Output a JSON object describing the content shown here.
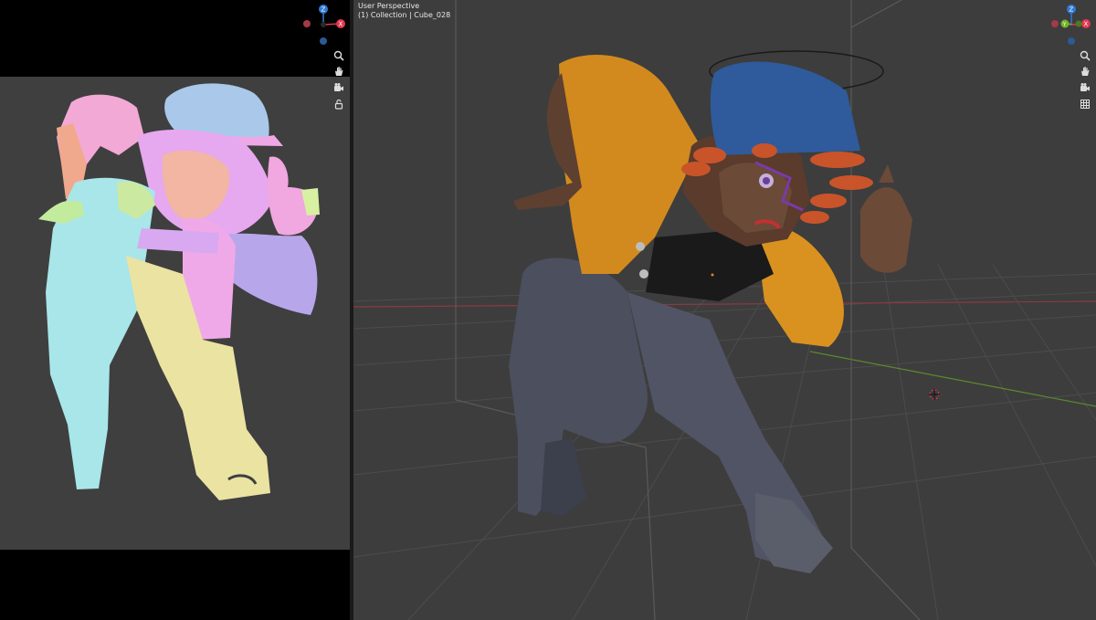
{
  "viewport": {
    "perspective_label": "User Perspective",
    "collection_label": "(1) Collection | Cube_028"
  },
  "gizmo": {
    "axis_z": "Z",
    "axis_x": "X",
    "axis_y": "Y"
  },
  "colors": {
    "axis_x": "#e0384e",
    "axis_y": "#72b42b",
    "axis_z": "#2f7ad6",
    "viewport_bg": "#3d3d3d",
    "render_bg": "#3f3f3f"
  },
  "tools": {
    "left": [
      "zoom-icon",
      "hand-pan-icon",
      "camera-icon",
      "lock-icon"
    ],
    "right": [
      "zoom-icon",
      "hand-pan-icon",
      "camera-icon",
      "grid-icon"
    ]
  }
}
